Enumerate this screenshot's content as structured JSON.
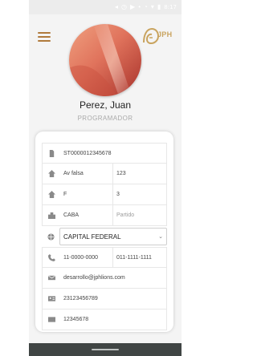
{
  "status_bar": {
    "time": "8:17",
    "icons": [
      "notification-icon",
      "alarm-icon",
      "youtube-icon",
      "dot-icon",
      "signal-icon",
      "wifi-icon",
      "battery-icon"
    ]
  },
  "header": {
    "menu_icon": "hamburger-icon",
    "logo_text": "JPH"
  },
  "profile": {
    "name": "Perez, Juan",
    "role": "PROGRAMADOR"
  },
  "form": {
    "account_number": "ST0000012345678",
    "street": {
      "value": "Av falsa",
      "number": "123"
    },
    "floor": {
      "value": "F",
      "unit": "3"
    },
    "city": {
      "value": "CABA",
      "partido_placeholder": "Partido"
    },
    "province": {
      "selected": "CAPITAL FEDERAL"
    },
    "phones": {
      "primary": "11-0000-0000",
      "secondary": "011-1111-1111"
    },
    "email": "desarrollo@jphlions.com",
    "dni": "23123456789",
    "extra": "12345678"
  },
  "colors": {
    "accent": "#b07a3c",
    "logo": "#c9a45f",
    "avatar_start": "#e8876a",
    "avatar_end": "#b63e34"
  }
}
